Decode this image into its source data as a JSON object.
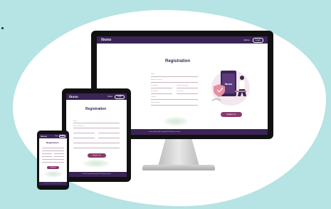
{
  "app": {
    "logo": "ibusu",
    "nav_home": "Home",
    "nav_login": "Login"
  },
  "form": {
    "title": "Registration",
    "fields": [
      "Name",
      "Email / Username",
      "Password",
      "Confirm Password",
      "First Name",
      "Last Name",
      "Country",
      "Phone Number"
    ],
    "submit_label": "Register me"
  },
  "footer_text": "© Ibusu Company. All Copyright 2022. All rights reserved.",
  "colors": {
    "nav": "#3a2456",
    "accent": "#8a3b6e",
    "background": "#b6e3e3"
  }
}
